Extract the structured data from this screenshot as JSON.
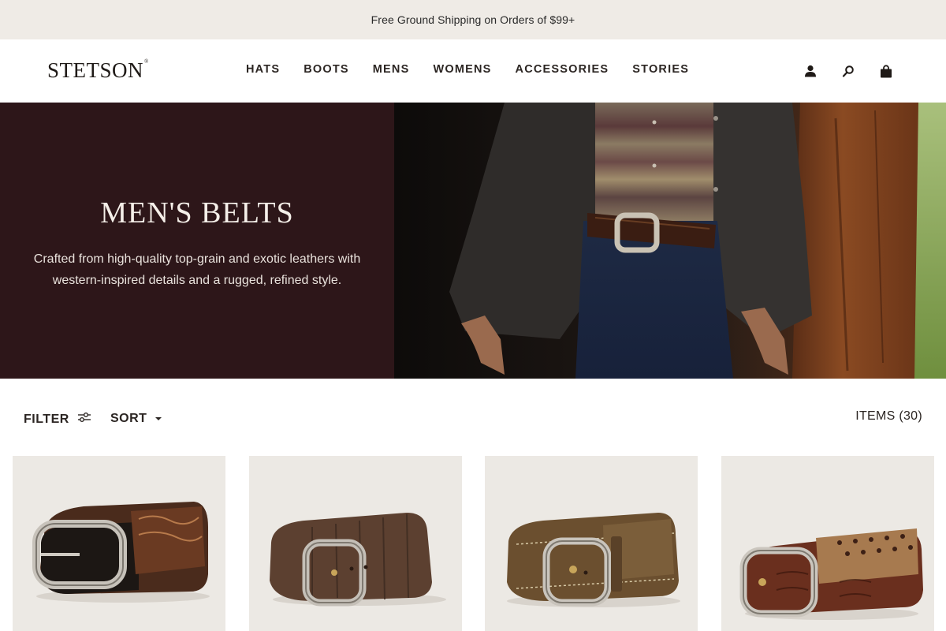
{
  "announcement": {
    "text": "Free Ground Shipping on Orders of $99+"
  },
  "header": {
    "logo": "STETSON",
    "nav": [
      {
        "label": "HATS"
      },
      {
        "label": "BOOTS"
      },
      {
        "label": "MENS"
      },
      {
        "label": "WOMENS"
      },
      {
        "label": "ACCESSORIES"
      },
      {
        "label": "STORIES"
      }
    ],
    "icons": [
      "account-icon",
      "search-icon",
      "cart-icon"
    ]
  },
  "hero": {
    "title": "MEN'S BELTS",
    "description": "Crafted from high-quality top-grain and exotic leathers with western-inspired details and a rugged, refined style."
  },
  "toolbar": {
    "filter_label": "FILTER",
    "sort_label": "SORT",
    "items_count": "ITEMS (30)"
  },
  "colors": {
    "announcement_bg": "#efebe6",
    "hero_panel_bg": "#2d1619",
    "product_card_bg": "#ece9e4",
    "text_dark": "#2b2522"
  }
}
